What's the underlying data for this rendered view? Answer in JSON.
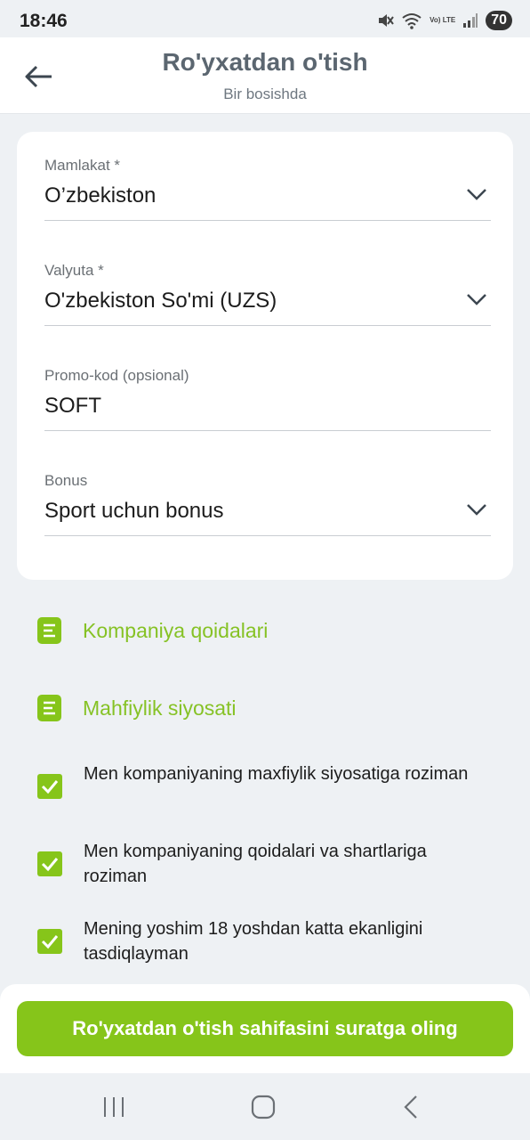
{
  "status_bar": {
    "time": "18:46",
    "battery": "70",
    "network": "Vo) LTE",
    "icons": [
      "mute-icon",
      "wifi-icon",
      "volte-icon",
      "signal-icon",
      "battery-icon"
    ]
  },
  "header": {
    "title": "Ro'yxatdan o'tish",
    "subtitle": "Bir bosishda"
  },
  "form": {
    "country": {
      "label": "Mamlakat *",
      "value": "O’zbekiston"
    },
    "currency": {
      "label": "Valyuta *",
      "value": "O'zbekiston So'mi (UZS)"
    },
    "promo": {
      "label": "Promo-kod (opsional)",
      "value": "SOFT"
    },
    "bonus": {
      "label": "Bonus",
      "value": "Sport uchun bonus"
    }
  },
  "links": {
    "rules": "Kompaniya qoidalari",
    "privacy": "Mahfiylik siyosati"
  },
  "agreements": [
    {
      "text": "Men kompaniyaning maxfiylik siyosatiga roziman",
      "checked": true
    },
    {
      "text": "Men kompaniyaning qoidalari va shartlariga roziman",
      "checked": true
    },
    {
      "text": "Mening yoshim 18 yoshdan katta ekanligini tasdiqlayman",
      "checked": true
    }
  ],
  "primary_button": "Ro'yxatdan o'tish sahifasini suratga oling",
  "colors": {
    "accent": "#86c51a",
    "link": "#86c225",
    "background": "#eef1f4",
    "title": "#5b6670"
  }
}
